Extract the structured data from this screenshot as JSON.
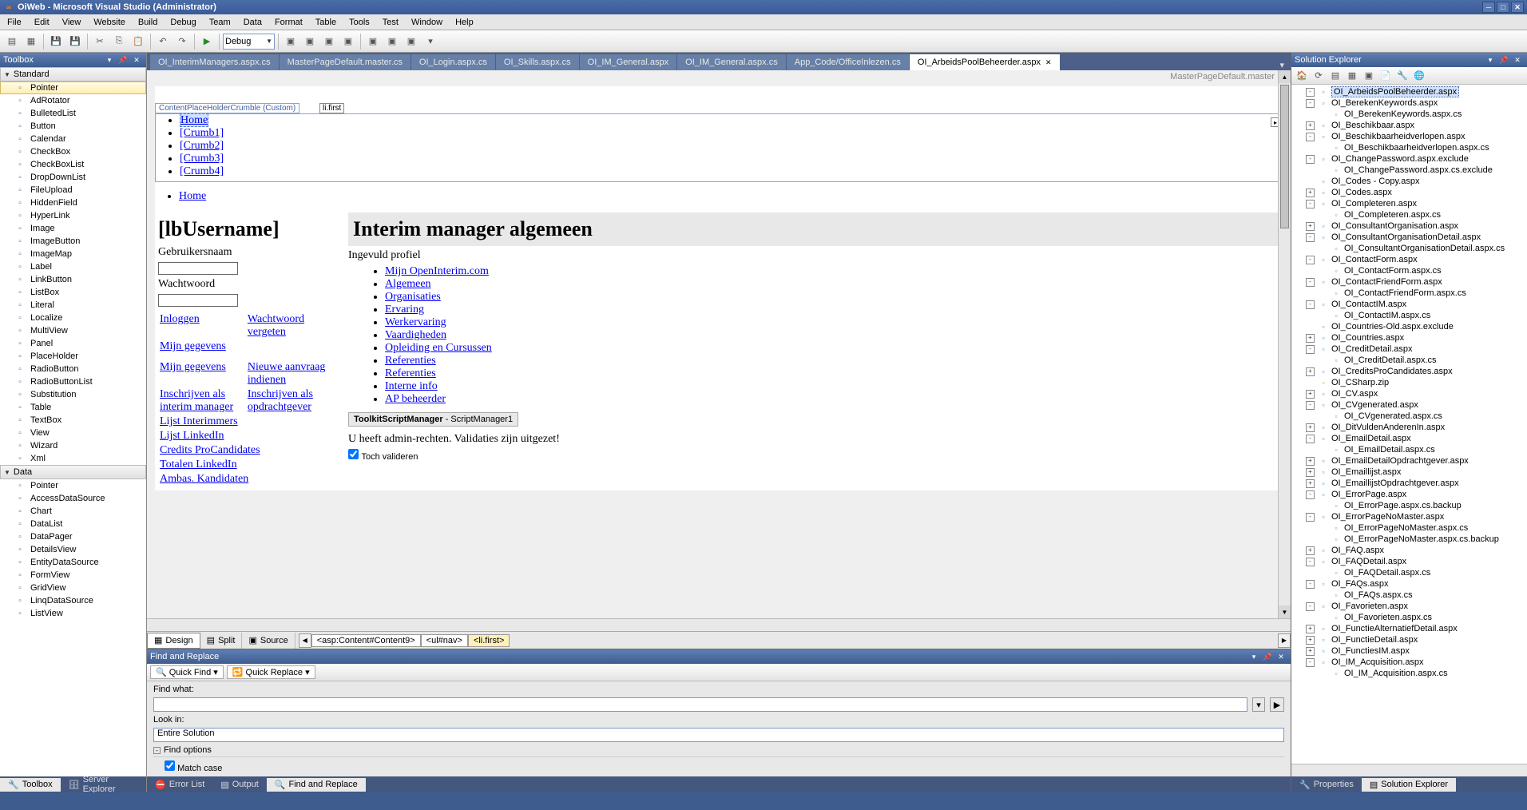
{
  "window": {
    "title": "OiWeb - Microsoft Visual Studio (Administrator)"
  },
  "menu": [
    "File",
    "Edit",
    "View",
    "Website",
    "Build",
    "Debug",
    "Team",
    "Data",
    "Format",
    "Table",
    "Tools",
    "Test",
    "Window",
    "Help"
  ],
  "toolbar": {
    "config": "Debug"
  },
  "toolbox": {
    "title": "Toolbox",
    "cat_standard": "Standard",
    "cat_data": "Data",
    "standard_items": [
      "Pointer",
      "AdRotator",
      "BulletedList",
      "Button",
      "Calendar",
      "CheckBox",
      "CheckBoxList",
      "DropDownList",
      "FileUpload",
      "HiddenField",
      "HyperLink",
      "Image",
      "ImageButton",
      "ImageMap",
      "Label",
      "LinkButton",
      "ListBox",
      "Literal",
      "Localize",
      "MultiView",
      "Panel",
      "PlaceHolder",
      "RadioButton",
      "RadioButtonList",
      "Substitution",
      "Table",
      "TextBox",
      "View",
      "Wizard",
      "Xml"
    ],
    "data_items": [
      "Pointer",
      "AccessDataSource",
      "Chart",
      "DataList",
      "DataPager",
      "DetailsView",
      "EntityDataSource",
      "FormView",
      "GridView",
      "LinqDataSource",
      "ListView"
    ]
  },
  "doc_tabs": [
    "OI_InterimManagers.aspx.cs",
    "MasterPageDefault.master.cs",
    "OI_Login.aspx.cs",
    "OI_Skills.aspx.cs",
    "OI_IM_General.aspx",
    "OI_IM_General.aspx.cs",
    "App_Code/OfficeInlezen.cs",
    "OI_ArbeidsPoolBeheerder.aspx"
  ],
  "active_tab": 7,
  "designer": {
    "master_label": "MasterPageDefault.master",
    "placeholder_tag": "ContentPlaceHolderCrumble (Custom)",
    "placeholder_tag2": "li.first",
    "crumbs": [
      "Home",
      "[Crumb1]",
      "[Crumb2]",
      "[Crumb3]",
      "[Crumb4]"
    ],
    "home2": "Home",
    "lb_username": "[lbUsername]",
    "gebruikersnaam": "Gebruikersnaam",
    "wachtwoord": "Wachtwoord",
    "inloggen": "Inloggen",
    "wachtwoord_vergeten": "Wachtwoord vergeten",
    "mijn_gegevens": "Mijn gegevens",
    "mijn_gegevens2": "Mijn gegevens",
    "nieuwe_aanvraag": "Nieuwe aanvraag indienen",
    "inschrijven_im": "Inschrijven als interim manager",
    "inschrijven_og": "Inschrijven als opdrachtgever",
    "lijst_interimmers": "Lijst Interimmers",
    "lijst_linkedin": "Lijst LinkedIn",
    "credits_pro": "Credits ProCandidates",
    "totalen_linkedin": "Totalen LinkedIn",
    "ambas": "Ambas. Kandidaten",
    "main_heading": "Interim manager algemeen",
    "ingevuld": "Ingevuld profiel",
    "profile_links": [
      "Mijn OpenInterim.com",
      "Algemeen",
      "Organisaties",
      "Ervaring",
      "Werkervaring",
      "Vaardigheden",
      "Opleiding en Cursussen",
      "Referenties",
      "Referenties",
      "Interne info",
      "AP beheerder"
    ],
    "script_mgr_bold": "ToolkitScriptManager",
    "script_mgr_rest": " - ScriptManager1",
    "admin_msg": "U heeft admin-rechten. Validaties zijn uitgezet!",
    "toch_valideren": "Toch valideren"
  },
  "view_tabs": {
    "design": "Design",
    "split": "Split",
    "source": "Source"
  },
  "path": [
    "<asp:Content#Content9>",
    "<ul#nav>",
    "<li.first>"
  ],
  "find": {
    "title": "Find and Replace",
    "quick_find": "Quick Find",
    "quick_replace": "Quick Replace",
    "find_what": "Find what:",
    "look_in": "Look in:",
    "look_in_val": "Entire Solution",
    "find_options": "Find options",
    "match_case": "Match case"
  },
  "solution": {
    "title": "Solution Explorer",
    "items": [
      {
        "d": 1,
        "exp": "-",
        "ic": "aspx",
        "t": "OI_ArbeidsPoolBeheerder.aspx",
        "sel": true
      },
      {
        "d": 1,
        "exp": "-",
        "ic": "aspx",
        "t": "OI_BerekenKeywords.aspx"
      },
      {
        "d": 2,
        "exp": "",
        "ic": "cs",
        "t": "OI_BerekenKeywords.aspx.cs"
      },
      {
        "d": 1,
        "exp": "+",
        "ic": "aspx",
        "t": "OI_Beschikbaar.aspx"
      },
      {
        "d": 1,
        "exp": "-",
        "ic": "aspx",
        "t": "OI_Beschikbaarheidverlopen.aspx"
      },
      {
        "d": 2,
        "exp": "",
        "ic": "cs",
        "t": "OI_Beschikbaarheidverlopen.aspx.cs"
      },
      {
        "d": 1,
        "exp": "-",
        "ic": "aspx",
        "t": "OI_ChangePassword.aspx.exclude"
      },
      {
        "d": 2,
        "exp": "",
        "ic": "cs",
        "t": "OI_ChangePassword.aspx.cs.exclude"
      },
      {
        "d": 1,
        "exp": "",
        "ic": "aspx",
        "t": "OI_Codes - Copy.aspx"
      },
      {
        "d": 1,
        "exp": "+",
        "ic": "aspx",
        "t": "OI_Codes.aspx"
      },
      {
        "d": 1,
        "exp": "-",
        "ic": "aspx",
        "t": "OI_Completeren.aspx"
      },
      {
        "d": 2,
        "exp": "",
        "ic": "cs",
        "t": "OI_Completeren.aspx.cs"
      },
      {
        "d": 1,
        "exp": "+",
        "ic": "aspx",
        "t": "OI_ConsultantOrganisation.aspx"
      },
      {
        "d": 1,
        "exp": "-",
        "ic": "aspx",
        "t": "OI_ConsultantOrganisationDetail.aspx"
      },
      {
        "d": 2,
        "exp": "",
        "ic": "cs",
        "t": "OI_ConsultantOrganisationDetail.aspx.cs"
      },
      {
        "d": 1,
        "exp": "-",
        "ic": "aspx",
        "t": "OI_ContactForm.aspx"
      },
      {
        "d": 2,
        "exp": "",
        "ic": "cs",
        "t": "OI_ContactForm.aspx.cs"
      },
      {
        "d": 1,
        "exp": "-",
        "ic": "aspx",
        "t": "OI_ContactFriendForm.aspx"
      },
      {
        "d": 2,
        "exp": "",
        "ic": "cs",
        "t": "OI_ContactFriendForm.aspx.cs"
      },
      {
        "d": 1,
        "exp": "-",
        "ic": "aspx",
        "t": "OI_ContactIM.aspx"
      },
      {
        "d": 2,
        "exp": "",
        "ic": "cs",
        "t": "OI_ContactIM.aspx.cs"
      },
      {
        "d": 1,
        "exp": "",
        "ic": "aspx",
        "t": "OI_Countries-Old.aspx.exclude"
      },
      {
        "d": 1,
        "exp": "+",
        "ic": "aspx",
        "t": "OI_Countries.aspx"
      },
      {
        "d": 1,
        "exp": "-",
        "ic": "aspx",
        "t": "OI_CreditDetail.aspx"
      },
      {
        "d": 2,
        "exp": "",
        "ic": "cs",
        "t": "OI_CreditDetail.aspx.cs"
      },
      {
        "d": 1,
        "exp": "+",
        "ic": "aspx",
        "t": "OI_CreditsProCandidates.aspx"
      },
      {
        "d": 1,
        "exp": "",
        "ic": "zip",
        "t": "OI_CSharp.zip"
      },
      {
        "d": 1,
        "exp": "+",
        "ic": "aspx",
        "t": "OI_CV.aspx"
      },
      {
        "d": 1,
        "exp": "-",
        "ic": "aspx",
        "t": "OI_CVgenerated.aspx"
      },
      {
        "d": 2,
        "exp": "",
        "ic": "cs",
        "t": "OI_CVgenerated.aspx.cs"
      },
      {
        "d": 1,
        "exp": "+",
        "ic": "aspx",
        "t": "OI_DitVuldenAnderenIn.aspx"
      },
      {
        "d": 1,
        "exp": "-",
        "ic": "aspx",
        "t": "OI_EmailDetail.aspx"
      },
      {
        "d": 2,
        "exp": "",
        "ic": "cs",
        "t": "OI_EmailDetail.aspx.cs"
      },
      {
        "d": 1,
        "exp": "+",
        "ic": "aspx",
        "t": "OI_EmailDetailOpdrachtgever.aspx"
      },
      {
        "d": 1,
        "exp": "+",
        "ic": "aspx",
        "t": "OI_Emaillijst.aspx"
      },
      {
        "d": 1,
        "exp": "+",
        "ic": "aspx",
        "t": "OI_EmaillijstOpdrachtgever.aspx"
      },
      {
        "d": 1,
        "exp": "-",
        "ic": "aspx",
        "t": "OI_ErrorPage.aspx"
      },
      {
        "d": 2,
        "exp": "",
        "ic": "cs",
        "t": "OI_ErrorPage.aspx.cs.backup"
      },
      {
        "d": 1,
        "exp": "-",
        "ic": "aspx",
        "t": "OI_ErrorPageNoMaster.aspx"
      },
      {
        "d": 2,
        "exp": "",
        "ic": "cs",
        "t": "OI_ErrorPageNoMaster.aspx.cs"
      },
      {
        "d": 2,
        "exp": "",
        "ic": "cs",
        "t": "OI_ErrorPageNoMaster.aspx.cs.backup"
      },
      {
        "d": 1,
        "exp": "+",
        "ic": "aspx",
        "t": "OI_FAQ.aspx"
      },
      {
        "d": 1,
        "exp": "-",
        "ic": "aspx",
        "t": "OI_FAQDetail.aspx"
      },
      {
        "d": 2,
        "exp": "",
        "ic": "cs",
        "t": "OI_FAQDetail.aspx.cs"
      },
      {
        "d": 1,
        "exp": "-",
        "ic": "aspx",
        "t": "OI_FAQs.aspx"
      },
      {
        "d": 2,
        "exp": "",
        "ic": "cs",
        "t": "OI_FAQs.aspx.cs"
      },
      {
        "d": 1,
        "exp": "-",
        "ic": "aspx",
        "t": "OI_Favorieten.aspx"
      },
      {
        "d": 2,
        "exp": "",
        "ic": "cs",
        "t": "OI_Favorieten.aspx.cs"
      },
      {
        "d": 1,
        "exp": "+",
        "ic": "aspx",
        "t": "OI_FunctieAlternatiefDetail.aspx"
      },
      {
        "d": 1,
        "exp": "+",
        "ic": "aspx",
        "t": "OI_FunctieDetail.aspx"
      },
      {
        "d": 1,
        "exp": "+",
        "ic": "aspx",
        "t": "OI_FunctiesIM.aspx"
      },
      {
        "d": 1,
        "exp": "-",
        "ic": "aspx",
        "t": "OI_IM_Acquisition.aspx"
      },
      {
        "d": 2,
        "exp": "",
        "ic": "cs",
        "t": "OI_IM_Acquisition.aspx.cs"
      }
    ]
  },
  "bottom": {
    "toolbox_tab": "Toolbox",
    "server_explorer": "Server Explorer",
    "error_list": "Error List",
    "output": "Output",
    "find_replace": "Find and Replace",
    "properties": "Properties",
    "solution_explorer": "Solution Explorer"
  }
}
